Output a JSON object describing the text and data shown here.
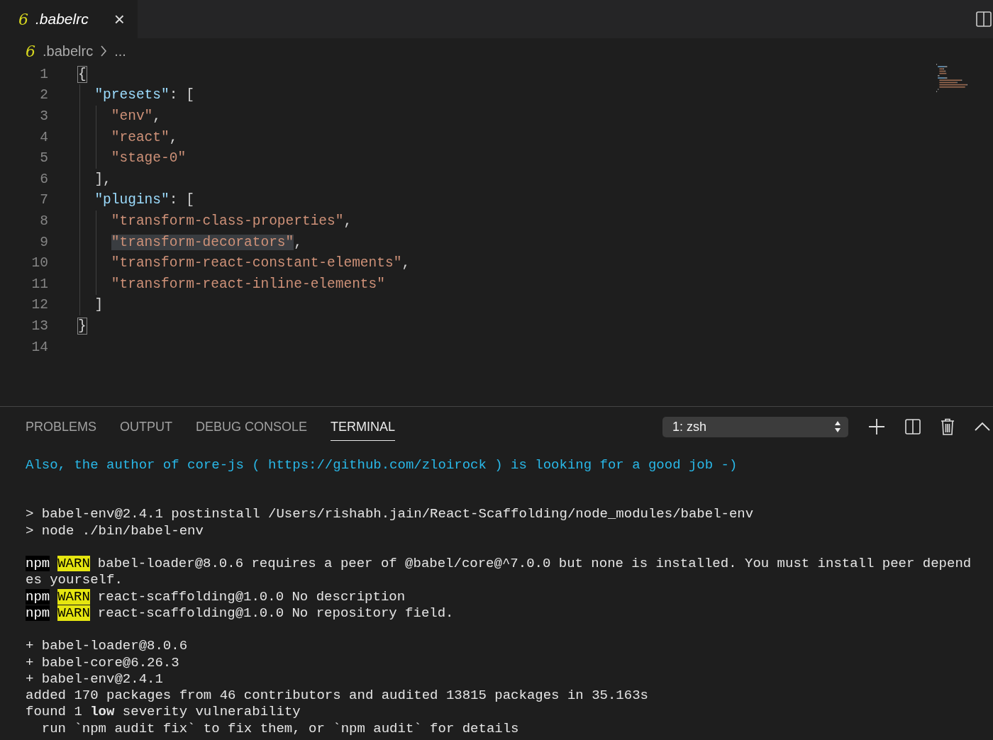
{
  "editor_tabs": [
    {
      "icon": "6",
      "label": ".babelrc",
      "selected": true,
      "close": "×"
    }
  ],
  "breadcrumb": {
    "icon": "6",
    "file": ".babelrc",
    "more": "..."
  },
  "code_lines": [
    {
      "number": "1",
      "tokens": [
        {
          "text": "{",
          "kind": "bracket-match"
        }
      ]
    },
    {
      "number": "2",
      "tokens": [
        {
          "text": "  \"presets\"",
          "kind": "key"
        },
        {
          "text": ": [",
          "kind": "punct"
        }
      ]
    },
    {
      "number": "3",
      "tokens": [
        {
          "text": "    \"env\"",
          "kind": "string"
        },
        {
          "text": ",",
          "kind": "punct"
        }
      ]
    },
    {
      "number": "4",
      "tokens": [
        {
          "text": "    \"react\"",
          "kind": "string"
        },
        {
          "text": ",",
          "kind": "punct"
        }
      ]
    },
    {
      "number": "5",
      "tokens": [
        {
          "text": "    \"stage-0\"",
          "kind": "string"
        }
      ]
    },
    {
      "number": "6",
      "tokens": [
        {
          "text": "  ],",
          "kind": "punct"
        }
      ]
    },
    {
      "number": "7",
      "tokens": [
        {
          "text": "  \"plugins\"",
          "kind": "key"
        },
        {
          "text": ": [",
          "kind": "punct"
        }
      ]
    },
    {
      "number": "8",
      "tokens": [
        {
          "text": "    \"transform-class-properties\"",
          "kind": "string"
        },
        {
          "text": ",",
          "kind": "punct"
        }
      ]
    },
    {
      "number": "9",
      "tokens": [
        {
          "text": "    \"transform-decorators\"",
          "kind": "string-highlight"
        },
        {
          "text": ",",
          "kind": "punct"
        }
      ]
    },
    {
      "number": "10",
      "tokens": [
        {
          "text": "    \"transform-react-constant-elements\"",
          "kind": "string"
        },
        {
          "text": ",",
          "kind": "punct"
        }
      ]
    },
    {
      "number": "11",
      "tokens": [
        {
          "text": "    \"transform-react-inline-elements\"",
          "kind": "string"
        }
      ]
    },
    {
      "number": "12",
      "tokens": [
        {
          "text": "  ]",
          "kind": "punct"
        }
      ]
    },
    {
      "number": "13",
      "tokens": [
        {
          "text": "}",
          "kind": "bracket-match"
        }
      ]
    },
    {
      "number": "14"
    }
  ],
  "panel": {
    "tabs": [
      {
        "label": "PROBLEMS",
        "selected": false
      },
      {
        "label": "OUTPUT",
        "selected": false
      },
      {
        "label": "DEBUG CONSOLE",
        "selected": false
      },
      {
        "label": "TERMINAL",
        "selected": true
      }
    ],
    "terminal_select": "1: zsh",
    "terminal_lines": [
      {
        "kind": "text",
        "segments": [
          {
            "text": "Also, the author of core-js ( https://github.com/zloirock ) is looking for a good job -)",
            "kind": "info"
          }
        ]
      },
      {
        "kind": "blank"
      },
      {
        "kind": "blank"
      },
      {
        "kind": "text",
        "segments": [
          {
            "text": "> babel-env@2.4.1 postinstall /Users/rishabh.jain/React-Scaffolding/node_modules/babel-env",
            "kind": "plain"
          }
        ]
      },
      {
        "kind": "text",
        "segments": [
          {
            "text": "> node ./bin/babel-env",
            "kind": "plain"
          }
        ]
      },
      {
        "kind": "blank"
      },
      {
        "kind": "text",
        "segments": [
          {
            "text": "npm",
            "kind": "npm"
          },
          {
            "text": "WARN",
            "kind": "warn"
          },
          {
            "text": "babel-loader@8.0.6 requires a peer of @babel/core@^7.0.0 but none is installed. You must install peer depend",
            "kind": "plain"
          }
        ]
      },
      {
        "kind": "text",
        "segments": [
          {
            "text": "es yourself.",
            "kind": "plain"
          }
        ]
      },
      {
        "kind": "text",
        "segments": [
          {
            "text": "npm",
            "kind": "npm"
          },
          {
            "text": "WARN",
            "kind": "warn"
          },
          {
            "text": "react-scaffolding@1.0.0 No description",
            "kind": "plain"
          }
        ]
      },
      {
        "kind": "text",
        "segments": [
          {
            "text": "npm",
            "kind": "npm"
          },
          {
            "text": "WARN",
            "kind": "warn"
          },
          {
            "text": "react-scaffolding@1.0.0 No repository field.",
            "kind": "plain"
          }
        ]
      },
      {
        "kind": "blank"
      },
      {
        "kind": "text",
        "segments": [
          {
            "text": "+ babel-loader@8.0.6",
            "kind": "plain"
          }
        ]
      },
      {
        "kind": "text",
        "segments": [
          {
            "text": "+ babel-core@6.26.3",
            "kind": "plain"
          }
        ]
      },
      {
        "kind": "text",
        "segments": [
          {
            "text": "+ babel-env@2.4.1",
            "kind": "plain"
          }
        ]
      },
      {
        "kind": "text",
        "segments": [
          {
            "text": "added 170 packages from 46 contributors and audited 13815 packages in 35.163s",
            "kind": "plain"
          }
        ]
      },
      {
        "kind": "text",
        "segments": [
          {
            "text": "found 1 **low** severity vulnerability",
            "kind": "plain"
          }
        ]
      },
      {
        "kind": "text",
        "segments": [
          {
            "text": "  run `npm audit fix` to fix them, or `npm audit` for details",
            "kind": "plain"
          }
        ]
      }
    ]
  }
}
